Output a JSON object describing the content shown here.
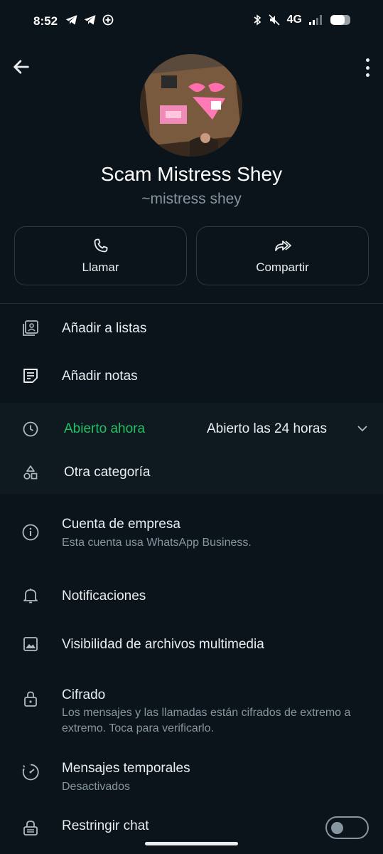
{
  "status_bar": {
    "time": "8:52",
    "network": "4G",
    "battery_level": 0.7,
    "icons": [
      "telegram-icon",
      "telegram-icon",
      "add-circle-icon",
      "bluetooth-icon",
      "mute-icon",
      "signal-icon",
      "battery-icon"
    ]
  },
  "profile": {
    "name": "Scam Mistress Shey",
    "subtitle": "~mistress shey"
  },
  "actions": {
    "call_label": "Llamar",
    "share_label": "Compartir"
  },
  "menu": {
    "add_to_lists": "Añadir a listas",
    "add_notes": "Añadir notas"
  },
  "business": {
    "open_status": "Abierto ahora",
    "hours": "Abierto las 24 horas",
    "category": "Otra categoría"
  },
  "settings": {
    "business_account_title": "Cuenta de empresa",
    "business_account_sub": "Esta cuenta usa WhatsApp Business.",
    "notifications": "Notificaciones",
    "media_visibility": "Visibilidad de archivos multimedia",
    "encryption_title": "Cifrado",
    "encryption_sub": "Los mensajes y las llamadas están cifrados de extremo a extremo. Toca para verificarlo.",
    "disappearing_title": "Mensajes temporales",
    "disappearing_sub": "Desactivados",
    "restrict_chat": "Restringir chat"
  },
  "colors": {
    "background": "#0b141a",
    "accent_green": "#21c063",
    "secondary_text": "#8696a0"
  }
}
